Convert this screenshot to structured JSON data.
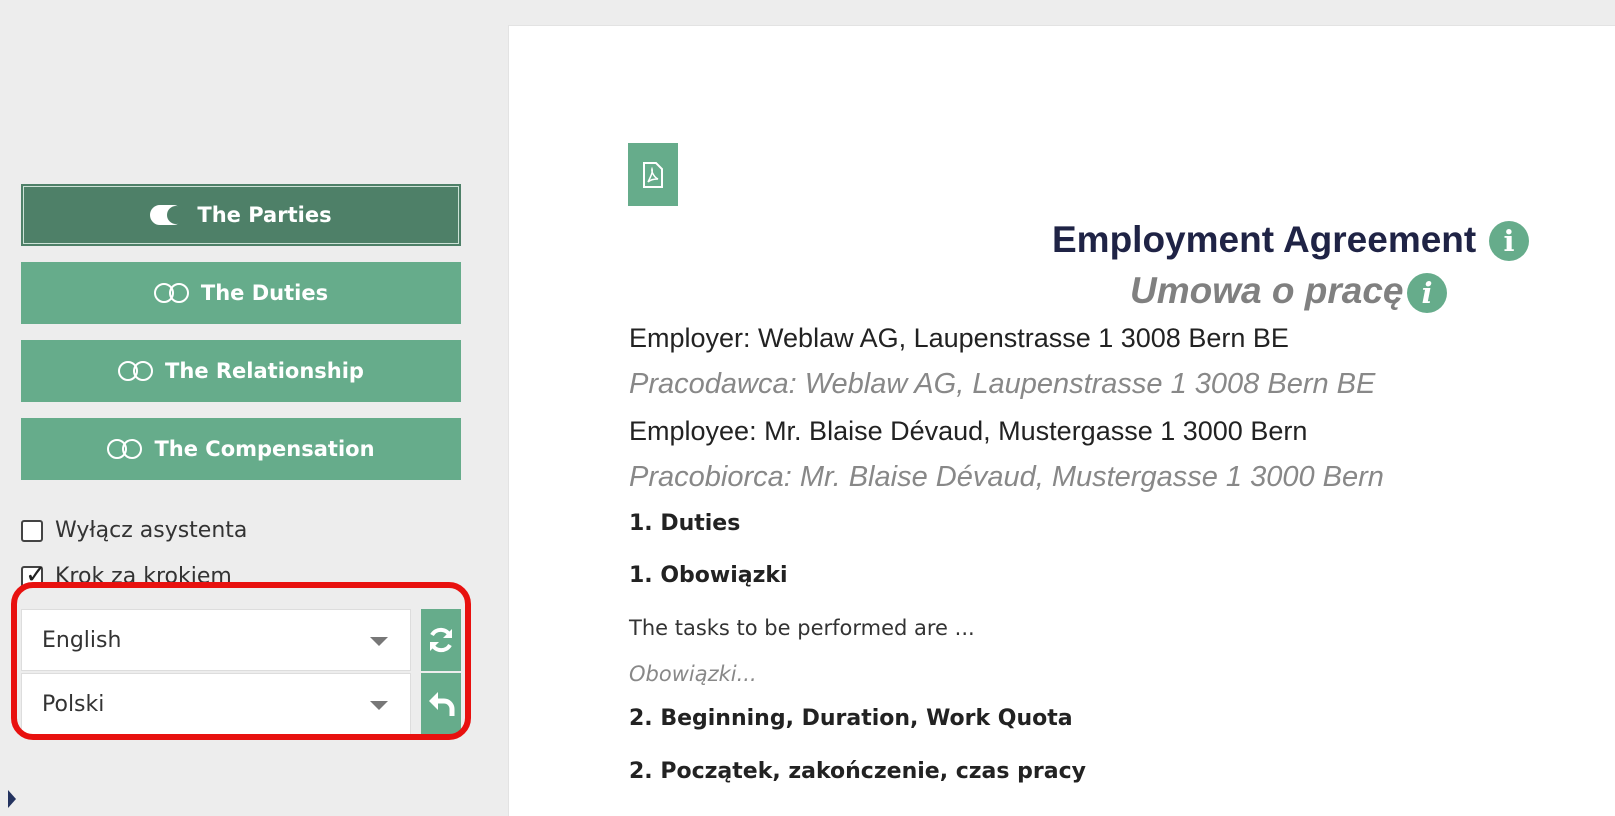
{
  "sidebar": {
    "sections": [
      {
        "label": "The Parties",
        "active": true
      },
      {
        "label": "The Duties",
        "active": false
      },
      {
        "label": "The Relationship",
        "active": false
      },
      {
        "label": "The Compensation",
        "active": false
      }
    ],
    "options": {
      "disable_assistant": {
        "label": "Wyłącz asystenta",
        "checked": false
      },
      "step_by_step": {
        "label": "Krok za krokiem",
        "checked": true
      }
    },
    "languages": {
      "primary": "English",
      "secondary": "Polski"
    }
  },
  "document": {
    "title": "Employment Agreement",
    "subtitle": "Umowa o pracę",
    "employer": "Employer: Weblaw AG, Laupenstrasse 1 3008 Bern BE",
    "employer_translation": "Pracodawca: Weblaw AG, Laupenstrasse 1 3008 Bern BE",
    "employee": "Employee: Mr. Blaise Dévaud, Mustergasse 1 3000 Bern",
    "employee_translation": "Pracobiorca: Mr. Blaise Dévaud, Mustergasse 1 3000 Bern",
    "sections": [
      {
        "heading": "1.  Duties",
        "heading_translation": "1.  Obowiązki",
        "text": "The tasks to be performed are ...",
        "text_translation": "Obowiązki..."
      },
      {
        "heading": "2.  Beginning, Duration, Work Quota",
        "heading_translation": "2.  Początek, zakończenie, czas pracy"
      }
    ]
  },
  "colors": {
    "accent": "#66ac8b",
    "accent_active": "#4e8068",
    "highlight": "#e8110f"
  }
}
